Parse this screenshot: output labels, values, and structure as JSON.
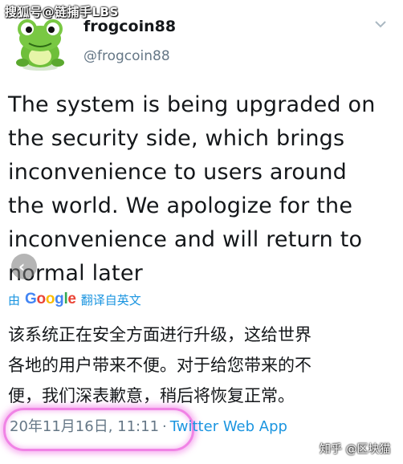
{
  "watermark_top": "搜狐号@链捕手LBS",
  "profile": {
    "display_name": "frogcoin88",
    "handle": "@frogcoin88"
  },
  "tweet": {
    "text_lines": [
      "The system is being upgraded on",
      "the security side, which brings",
      "inconvenience to users around",
      "the world. We apologize for the",
      "inconvenience and will return to",
      "normal later"
    ]
  },
  "translation": {
    "prefix": "由",
    "provider": "Google",
    "label": "翻译自英文",
    "text_lines": [
      "该系统正在安全方面进行升级，这给世界",
      "各地的用户带来不便。对于给您带来的不",
      "便，我们深表歉意，稍后将恢复正常。"
    ]
  },
  "meta": {
    "date": "20年11月16日, 11:11",
    "separator": "·",
    "source": "Twitter Web App"
  },
  "watermark_bottom": "知乎 @区块猫",
  "colors": {
    "link": "#1b95e0",
    "secondary_text": "#657786",
    "highlight": "#eb5adc"
  },
  "icons": {
    "avatar": "frog-avatar",
    "menu": "chevron-down-icon",
    "nav": "chevron-left-icon"
  }
}
